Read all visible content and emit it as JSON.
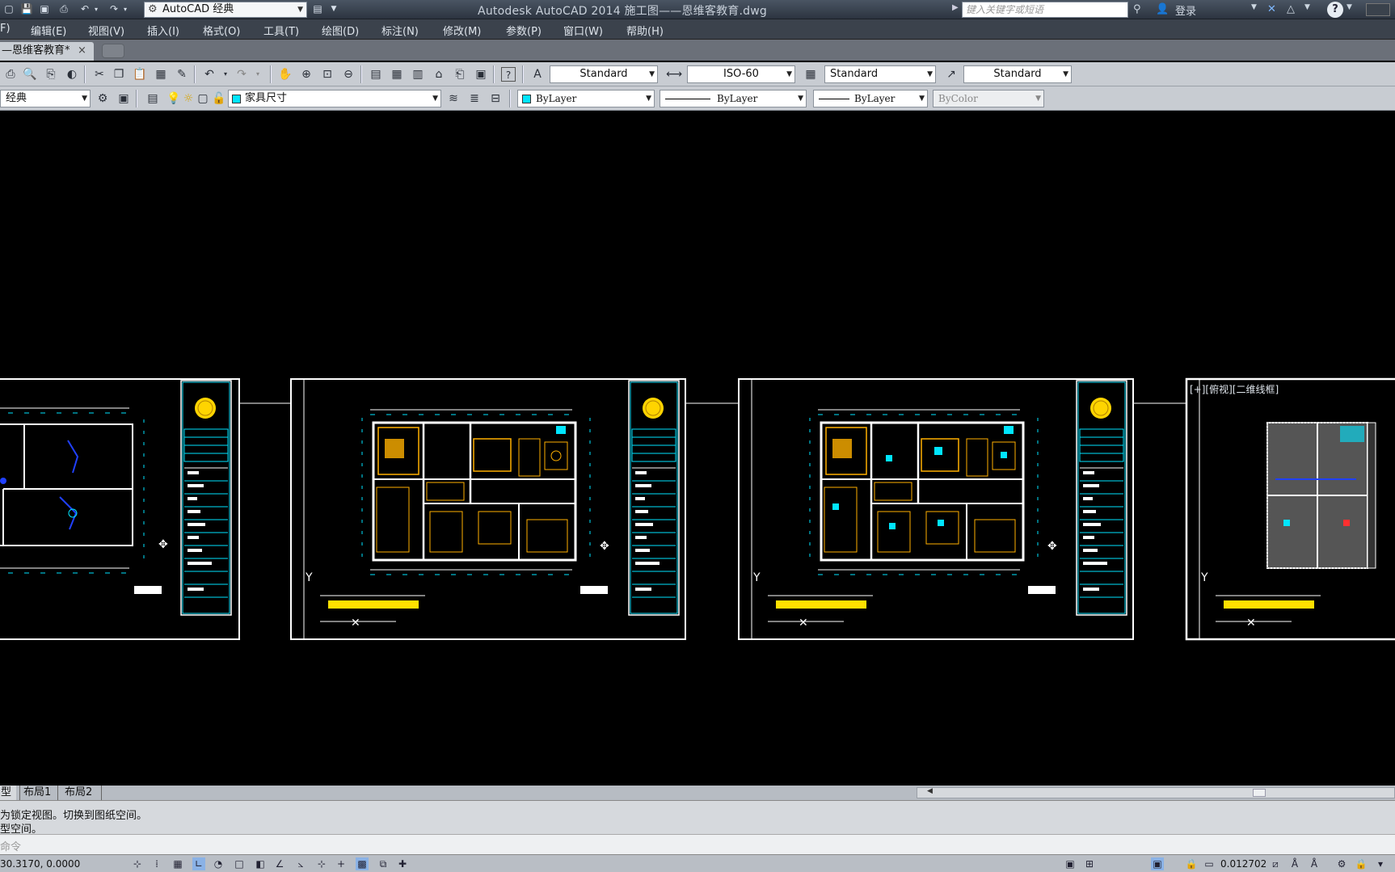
{
  "titlebar": {
    "workspace": "AutoCAD 经典",
    "app_title": "Autodesk AutoCAD 2014    施工图——恩维客教育.dwg",
    "search_placeholder": "键入关键字或短语",
    "signin": "登录",
    "help": "?"
  },
  "menu": [
    "F)",
    "编辑(E)",
    "视图(V)",
    "插入(I)",
    "格式(O)",
    "工具(T)",
    "绘图(D)",
    "标注(N)",
    "修改(M)",
    "参数(P)",
    "窗口(W)",
    "帮助(H)"
  ],
  "doc_tab": {
    "label": "—恩维客教育*",
    "close": "×"
  },
  "toolbar1": {
    "text_style": "Standard",
    "dim_style": "ISO-60",
    "table_style": "Standard",
    "mleader_style": "Standard"
  },
  "toolbar2": {
    "workspace_partial": "经典",
    "layer": "家具尺寸",
    "color": "ByLayer",
    "linetype": "ByLayer",
    "lineweight": "ByLayer",
    "plotstyle": "ByColor"
  },
  "viewport_label": "[+][俯视][二维线框]",
  "layout_tabs": [
    "型",
    "布局1",
    "布局2"
  ],
  "command": {
    "history_1": "为锁定视图。切换到图纸空间。",
    "history_2": "型空间。",
    "prompt": "命令"
  },
  "status": {
    "coordinates": "30.3170,  0.0000",
    "scale": "0.012702"
  },
  "colors": {
    "canvas": "#000000",
    "sheet_border": "#ffffff",
    "cyan": "#00e5ff",
    "yellow": "#ffe000",
    "orange": "#ffb000",
    "blue": "#2040ff"
  }
}
